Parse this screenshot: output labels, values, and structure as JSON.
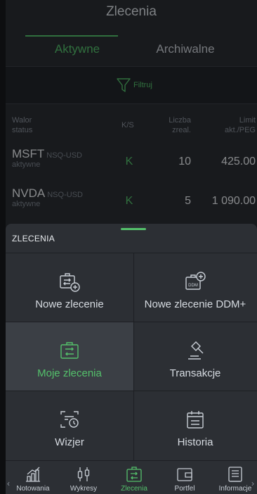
{
  "header": {
    "title": "Zlecenia"
  },
  "tabs": [
    {
      "label": "Aktywne",
      "active": true
    },
    {
      "label": "Archiwalne",
      "active": false
    }
  ],
  "filter": {
    "label": "Filtruj",
    "icon": "funnel-icon"
  },
  "table": {
    "columns": {
      "walor": "Walor",
      "status": "status",
      "ks": "K/S",
      "liczba": "Liczba",
      "zreal": "zreal.",
      "limit": "Limit",
      "akt": "akt./PEG"
    },
    "rows": [
      {
        "name": "MSFT",
        "exchange": "NSQ-USD",
        "status": "aktywne",
        "ks": "K",
        "qty": "10",
        "limit": "425.00"
      },
      {
        "name": "NVDA",
        "exchange": "NSQ-USD",
        "status": "aktywne",
        "ks": "K",
        "qty": "5",
        "limit": "1 090.00"
      }
    ]
  },
  "sheet": {
    "title": "ZLECENIA",
    "tiles": [
      {
        "label": "Nowe zlecenie",
        "icon": "new-order-icon",
        "active": false
      },
      {
        "label": "Nowe zlecenie DDM+",
        "icon": "new-order-ddm-icon",
        "active": false
      },
      {
        "label": "Moje zlecenia",
        "icon": "my-orders-icon",
        "active": true
      },
      {
        "label": "Transakcje",
        "icon": "gavel-icon",
        "active": false
      },
      {
        "label": "Wizjer",
        "icon": "viewer-icon",
        "active": false
      },
      {
        "label": "Historia",
        "icon": "calendar-icon",
        "active": false
      }
    ]
  },
  "nav": {
    "items": [
      {
        "label": "Notowania",
        "icon": "chart-icon",
        "active": false
      },
      {
        "label": "Wykresy",
        "icon": "candles-icon",
        "active": false
      },
      {
        "label": "Zlecenia",
        "icon": "orders-icon",
        "active": true
      },
      {
        "label": "Portfel",
        "icon": "wallet-icon",
        "active": false
      },
      {
        "label": "Informacje",
        "icon": "news-icon",
        "active": false
      }
    ]
  },
  "colors": {
    "accent": "#54c06b",
    "sheet": "#2c2f34",
    "background": "#2a2d33"
  }
}
